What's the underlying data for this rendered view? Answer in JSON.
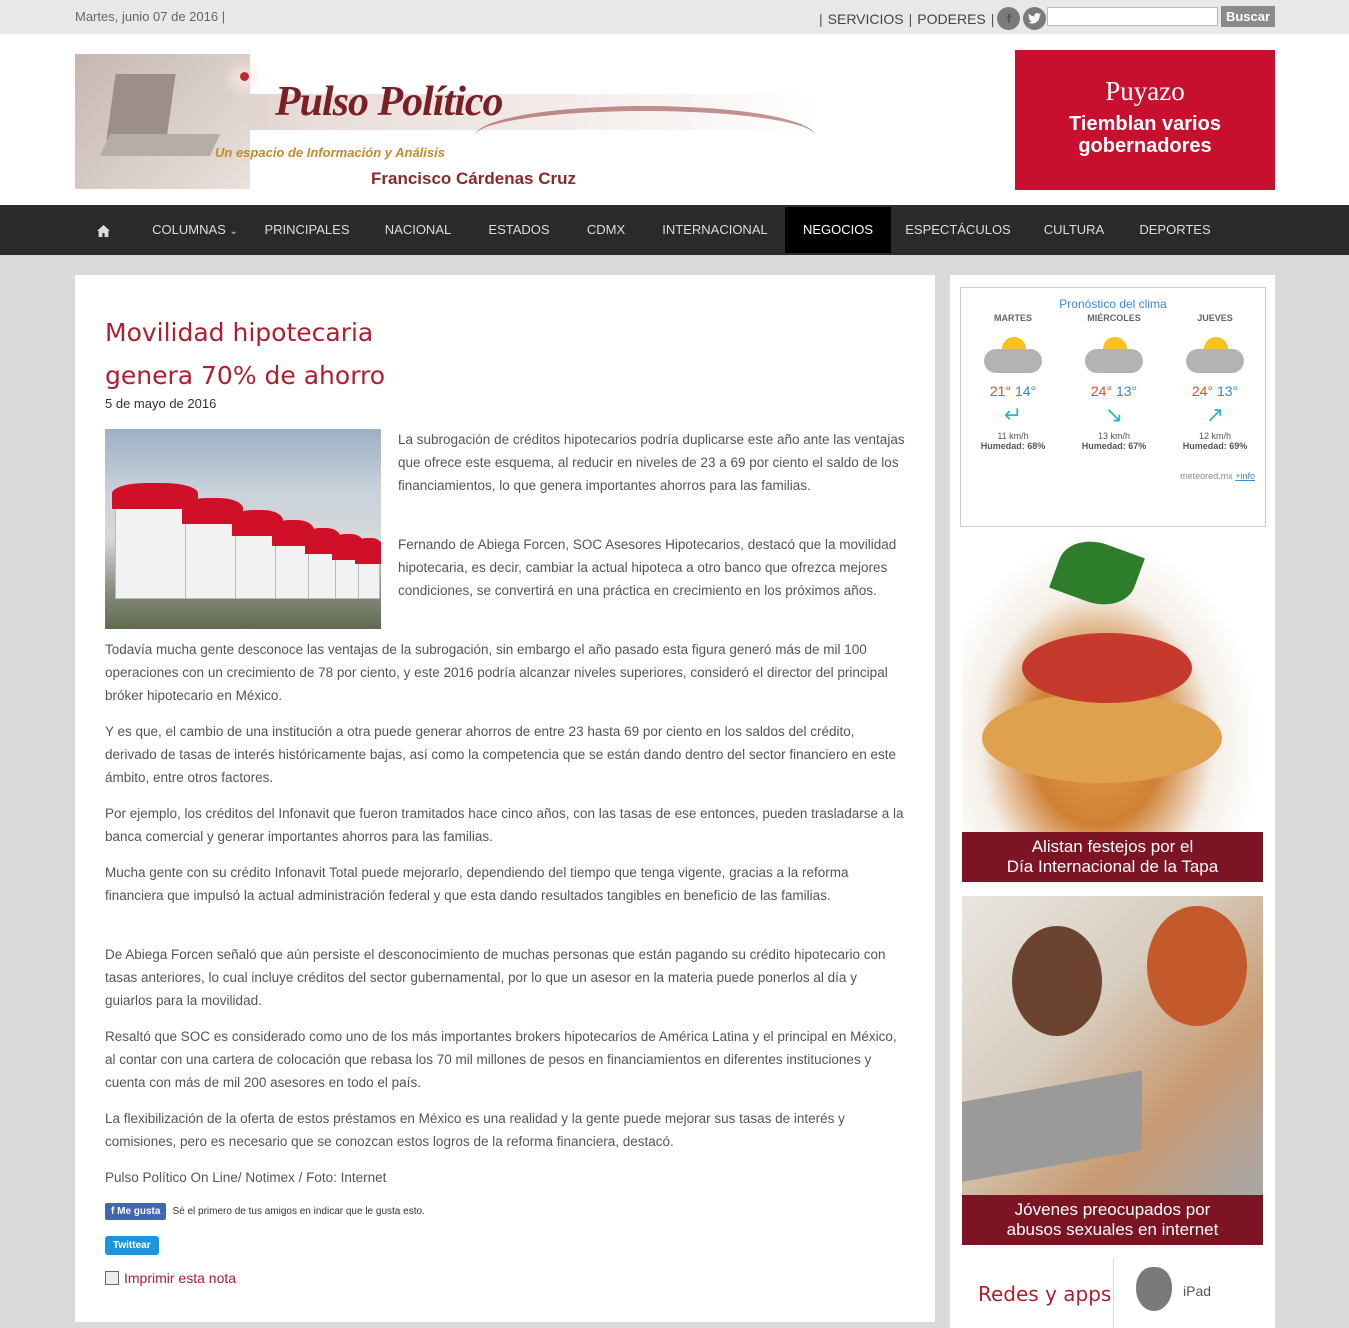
{
  "topbar": {
    "date": "Martes, junio 07 de 2016 |",
    "sep": "|",
    "servicios": "SERVICIOS",
    "sep2": "|",
    "poderes": "PODERES",
    "sep3": "|",
    "search_button": "Buscar"
  },
  "header": {
    "logo_title": "Pulso Político",
    "logo_subtitle": "Un espacio de Información y Análisis",
    "logo_author": "Francisco Cárdenas Cruz",
    "promo_kicker": "Puyazo",
    "promo_headline": "Tiemblan varios gobernadores"
  },
  "nav": [
    "COLUMNAS",
    "PRINCIPALES",
    "NACIONAL",
    "ESTADOS",
    "CDMX",
    "INTERNACIONAL",
    "NEGOCIOS",
    "ESPECTÁCULOS",
    "CULTURA",
    "DEPORTES"
  ],
  "article": {
    "title_line1": "Movilidad hipotecaria",
    "title_line2": "genera 70% de ahorro",
    "date": "5 de mayo de 2016",
    "paragraphs": [
      "La subrogación de créditos hipotecarios podría duplicarse este año ante las ventajas que ofrece este esquema, al reducir en niveles de 23 a 69 por ciento el saldo de los financiamientos, lo que genera importantes ahorros para las familias.",
      "Fernando de Abiega Forcen, SOC Asesores Hipotecarios, destacó que la movilidad hipotecaria, es decir, cambiar la actual hipoteca a otro banco que ofrezca mejores condiciones, se convertirá en una práctica en crecimiento en los próximos años.",
      "Todavía mucha gente desconoce las ventajas de la subrogación, sin embargo el año pasado esta figura generó más de mil 100 operaciones con un crecimiento de 78 por ciento, y este 2016 podría alcanzar niveles superiores, consideró el director del principal bróker hipotecario en México.",
      "Y es que, el cambio de una institución a otra puede generar ahorros de entre 23 hasta 69 por ciento en los saldos del crédito, derivado de tasas de interés históricamente bajas, así como la competencia que se están dando dentro del sector financiero en este ámbito, entre otros factores.",
      "Por ejemplo, los créditos del Infonavit que fueron tramitados hace cinco años, con las tasas de ese entonces, pueden trasladarse a la banca comercial y generar importantes ahorros para las familias.",
      "Mucha gente con su crédito Infonavit Total puede mejorarlo, dependiendo del tiempo que tenga vigente, gracias a la reforma financiera que impulsó la actual administración federal y que esta dando resultados tangibles en beneficio de las familias.",
      "De Abiega Forcen señaló que aún persiste el desconocimiento de muchas personas que están pagando su crédito hipotecario con tasas anteriores, lo cual incluye créditos del sector gubernamental, por lo que un asesor en la materia puede ponerlos al día y guiarlos para la movilidad.",
      "Resaltó que SOC es considerado como uno de los más importantes brokers hipotecarios de América Latina y el principal en México, al contar con una cartera de colocación que rebasa los 70 mil millones de pesos en financiamientos en diferentes instituciones y cuenta con más de mil 200 asesores en todo el país.",
      "La flexibilización de la oferta de estos préstamos en México es una realidad y la gente puede mejorar sus tasas de interés y comisiones, pero es necesario que se conozcan estos logros de la reforma financiera, destacó.",
      "Pulso Político On Line/ Notimex / Foto: Internet"
    ],
    "fb_like": "Me gusta",
    "fb_text": "Sé el primero de tus amigos en indicar que le gusta esto.",
    "tweet": "Twittear",
    "print": "Imprimir esta nota"
  },
  "weather": {
    "title": "Pronóstico del clima",
    "days": [
      {
        "name": "MARTES",
        "hi": "21°",
        "lo": "14°",
        "wind": "11 km/h",
        "hum_label": "Humedad:",
        "hum": "68%"
      },
      {
        "name": "MIÉRCOLES",
        "hi": "24°",
        "lo": "13°",
        "wind": "13 km/h",
        "hum_label": "Humedad:",
        "hum": "67%"
      },
      {
        "name": "JUEVES",
        "hi": "24°",
        "lo": "13°",
        "wind": "12 km/h",
        "hum_label": "Humedad:",
        "hum": "69%"
      }
    ],
    "source": "meteored.mx",
    "more": "+info"
  },
  "sidebar": {
    "caption1_line1": "Alistan festejos por el",
    "caption1_line2": "Día Internacional de la Tapa",
    "caption2_line1": "Jóvenes preocupados por",
    "caption2_line2": "abusos sexuales en internet",
    "redes": "Redes y apps",
    "ipad": "iPad"
  }
}
